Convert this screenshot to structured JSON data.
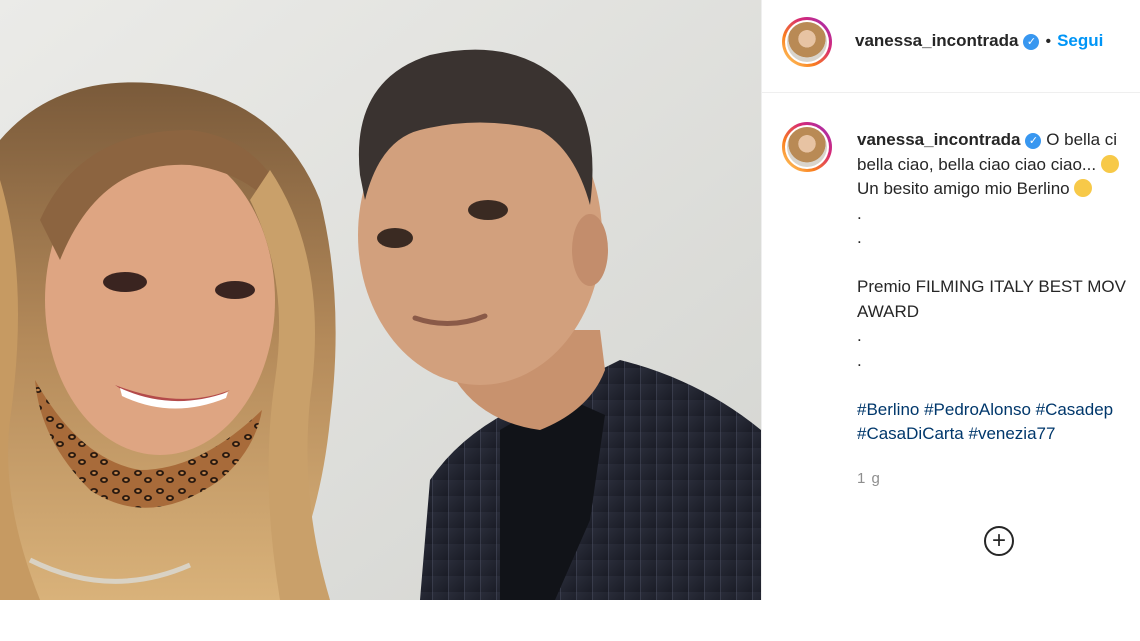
{
  "post": {
    "username": "vanessa_incontrada",
    "verified": true,
    "follow_label": "Segui",
    "separator": "•",
    "caption_lines": [
      "O bella ci",
      "bella ciao, bella ciao ciao ciao...",
      "Un besito amigo mio Berlino",
      ".",
      ".",
      "",
      "Premio FILMING ITALY BEST MOV",
      "AWARD",
      ".",
      ".",
      "",
      "#Berlino #PedroAlonso #Casadep",
      "#CasaDiCarta #venezia77"
    ],
    "time_ago": "1 g"
  },
  "icons": {
    "verified": "verified-badge-icon",
    "add_comment": "plus-circle-icon",
    "emoji": "smile-emoji-icon"
  },
  "colors": {
    "link_blue": "#0095f6",
    "verified_blue": "#3897f0",
    "hashtag": "#00376b",
    "muted": "#8e8e8e"
  }
}
